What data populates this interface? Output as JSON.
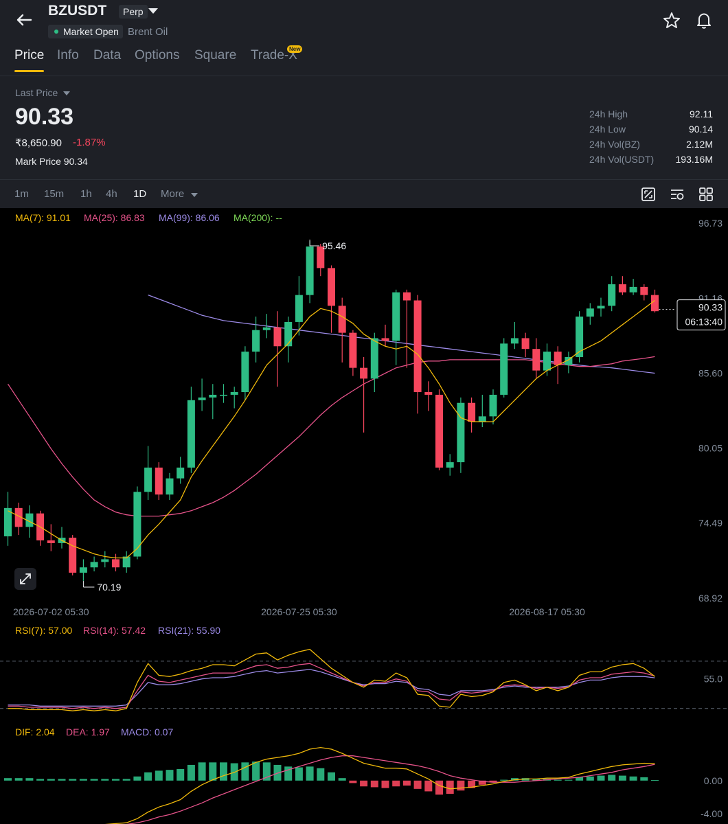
{
  "header": {
    "symbol": "BZUSDT",
    "contract_type": "Perp",
    "market_status": "Market Open",
    "underlying": "Brent Oil",
    "icons": [
      "back-arrow-icon",
      "chevron-down-icon",
      "star-icon",
      "bell-icon"
    ]
  },
  "tabs": [
    {
      "label": "Price",
      "active": true
    },
    {
      "label": "Info",
      "active": false
    },
    {
      "label": "Data",
      "active": false
    },
    {
      "label": "Options",
      "active": false
    },
    {
      "label": "Square",
      "active": false
    },
    {
      "label": "Trade-X",
      "active": false,
      "badge": "New"
    }
  ],
  "price": {
    "last_label": "Last Price",
    "last": "90.33",
    "inr": "₹8,650.90",
    "change": "-1.87%",
    "mark_label": "Mark Price",
    "mark": "90.34"
  },
  "stats": [
    {
      "label": "24h High",
      "value": "92.11"
    },
    {
      "label": "24h Low",
      "value": "90.14"
    },
    {
      "label": "24h Vol(BZ)",
      "value": "2.12M"
    },
    {
      "label": "24h Vol(USDT)",
      "value": "193.16M"
    }
  ],
  "intervals": {
    "items": [
      {
        "label": "1m",
        "active": false
      },
      {
        "label": "15m",
        "active": false
      },
      {
        "label": "1h",
        "active": false
      },
      {
        "label": "4h",
        "active": false
      },
      {
        "label": "1D",
        "active": true
      }
    ],
    "more_label": "More",
    "tool_icons": [
      "chart-settings-icon",
      "indicator-settings-icon",
      "layout-grid-icon"
    ]
  },
  "chart_data": [
    {
      "type": "candlestick",
      "ma_legend": [
        {
          "text": "MA(7): 91.01",
          "color": "#f0b90b"
        },
        {
          "text": "MA(25): 86.83",
          "color": "#e6538a"
        },
        {
          "text": "MA(99): 86.06",
          "color": "#9b8ae6"
        },
        {
          "text": "MA(200): --",
          "color": "#7ed957"
        }
      ],
      "y_ticks": [
        "96.73",
        "91.16",
        "85.60",
        "80.05",
        "74.49",
        "68.92"
      ],
      "ylim": [
        68.92,
        96.73
      ],
      "x_ticks": [
        {
          "label": "2026-07-02 05:30",
          "index": 4
        },
        {
          "label": "2026-07-25 05:30",
          "index": 27
        },
        {
          "label": "2026-08-17 05:30",
          "index": 50
        }
      ],
      "high_marker": {
        "value": "95.46",
        "index": 28
      },
      "low_marker": {
        "value": "70.19",
        "index": 7
      },
      "current_price_tag": {
        "price": "90.33",
        "countdown": "06:13:40"
      },
      "candles": [
        [
          73.5,
          75.6,
          72.8,
          76.8
        ],
        [
          75.6,
          74.2,
          73.6,
          76.0
        ],
        [
          74.2,
          75.2,
          73.4,
          75.8
        ],
        [
          75.2,
          73.2,
          72.8,
          75.4
        ],
        [
          73.2,
          73.0,
          72.4,
          74.4
        ],
        [
          73.0,
          73.4,
          72.6,
          74.2
        ],
        [
          73.4,
          70.8,
          70.6,
          73.6
        ],
        [
          70.8,
          71.2,
          70.2,
          71.8
        ],
        [
          71.2,
          71.6,
          70.9,
          72.0
        ],
        [
          71.6,
          71.8,
          71.2,
          72.4
        ],
        [
          71.8,
          71.2,
          70.9,
          72.2
        ],
        [
          71.2,
          72.0,
          70.8,
          72.4
        ],
        [
          72.0,
          76.8,
          71.8,
          77.2
        ],
        [
          76.8,
          78.6,
          76.2,
          80.2
        ],
        [
          78.6,
          76.6,
          76.2,
          79.0
        ],
        [
          76.6,
          77.8,
          76.2,
          78.2
        ],
        [
          77.8,
          78.6,
          77.4,
          79.4
        ],
        [
          78.6,
          83.6,
          78.2,
          84.6
        ],
        [
          83.6,
          83.8,
          82.8,
          85.2
        ],
        [
          83.8,
          84.0,
          82.2,
          84.8
        ],
        [
          84.0,
          84.0,
          83.4,
          84.8
        ],
        [
          84.0,
          84.2,
          83.0,
          84.6
        ],
        [
          84.2,
          87.2,
          83.6,
          87.6
        ],
        [
          87.2,
          88.8,
          86.4,
          89.8
        ],
        [
          88.8,
          89.0,
          88.2,
          90.0
        ],
        [
          89.0,
          87.6,
          84.6,
          90.2
        ],
        [
          87.6,
          89.4,
          86.4,
          89.8
        ],
        [
          89.4,
          91.4,
          88.4,
          92.8
        ],
        [
          91.4,
          95.0,
          90.8,
          95.4
        ],
        [
          95.0,
          93.4,
          92.8,
          95.2
        ],
        [
          93.4,
          90.6,
          88.6,
          93.6
        ],
        [
          90.6,
          88.6,
          86.4,
          91.2
        ],
        [
          88.6,
          86.0,
          85.4,
          88.8
        ],
        [
          86.0,
          85.2,
          81.2,
          86.8
        ],
        [
          85.2,
          88.2,
          84.2,
          88.6
        ],
        [
          88.2,
          88.0,
          87.6,
          89.2
        ],
        [
          88.0,
          91.6,
          86.2,
          91.8
        ],
        [
          91.6,
          91.0,
          86.0,
          91.8
        ],
        [
          91.0,
          84.2,
          82.6,
          91.4
        ],
        [
          84.2,
          84.0,
          82.8,
          85.0
        ],
        [
          84.0,
          78.6,
          78.4,
          84.4
        ],
        [
          78.6,
          79.0,
          78.0,
          79.6
        ],
        [
          79.0,
          83.4,
          78.2,
          83.8
        ],
        [
          83.4,
          82.0,
          81.2,
          83.8
        ],
        [
          82.0,
          82.4,
          81.6,
          84.0
        ],
        [
          82.4,
          84.0,
          81.8,
          84.4
        ],
        [
          84.0,
          87.8,
          83.8,
          88.2
        ],
        [
          87.8,
          88.2,
          87.4,
          89.4
        ],
        [
          88.2,
          87.4,
          86.8,
          88.6
        ],
        [
          87.4,
          85.8,
          85.2,
          88.2
        ],
        [
          85.8,
          87.2,
          85.4,
          87.8
        ],
        [
          87.2,
          86.2,
          84.8,
          87.6
        ],
        [
          86.2,
          86.8,
          85.6,
          87.2
        ],
        [
          86.8,
          89.8,
          86.4,
          90.2
        ],
        [
          89.8,
          90.4,
          89.2,
          90.8
        ],
        [
          90.4,
          90.6,
          89.8,
          91.2
        ],
        [
          90.6,
          92.2,
          90.2,
          92.8
        ],
        [
          92.2,
          91.6,
          91.4,
          92.8
        ],
        [
          91.6,
          92.0,
          91.4,
          92.6
        ],
        [
          92.0,
          91.4,
          91.0,
          92.2
        ],
        [
          91.4,
          90.2,
          90.1,
          91.8
        ]
      ],
      "ma7": [
        75.4,
        75.0,
        74.6,
        74.2,
        73.7,
        73.2,
        72.8,
        72.5,
        72.2,
        72.0,
        71.9,
        71.9,
        72.6,
        73.6,
        74.4,
        75.3,
        76.2,
        77.9,
        79.1,
        80.2,
        81.3,
        82.4,
        83.6,
        84.9,
        86.2,
        87.0,
        87.8,
        88.8,
        89.8,
        90.4,
        90.2,
        89.8,
        89.3,
        88.5,
        88.0,
        87.6,
        87.4,
        87.6,
        87.0,
        86.0,
        84.8,
        83.4,
        82.3,
        82.0,
        82.0,
        82.0,
        82.8,
        83.6,
        84.4,
        85.2,
        85.8,
        86.2,
        86.6,
        87.2,
        87.6,
        88.0,
        88.6,
        89.2,
        89.8,
        90.4,
        91.0
      ],
      "ma25": [
        84.8,
        83.6,
        82.4,
        81.2,
        80.0,
        78.9,
        77.9,
        77.0,
        76.2,
        75.7,
        75.3,
        75.1,
        75.0,
        75.0,
        75.0,
        75.1,
        75.2,
        75.4,
        75.7,
        76.0,
        76.4,
        76.9,
        77.5,
        78.1,
        78.8,
        79.5,
        80.2,
        80.9,
        81.7,
        82.5,
        83.2,
        83.8,
        84.3,
        84.8,
        85.2,
        85.6,
        86.0,
        86.2,
        86.4,
        86.5,
        86.5,
        86.6,
        86.6,
        86.6,
        86.6,
        86.6,
        86.6,
        86.6,
        86.6,
        86.5,
        86.4,
        86.3,
        86.2,
        86.1,
        86.1,
        86.2,
        86.3,
        86.5,
        86.6,
        86.7,
        86.83
      ],
      "ma99_start": 13,
      "ma99": [
        91.4,
        91.1,
        90.8,
        90.5,
        90.2,
        89.9,
        89.7,
        89.5,
        89.4,
        89.3,
        89.2,
        89.1,
        89.0,
        88.9,
        88.8,
        88.7,
        88.6,
        88.5,
        88.4,
        88.3,
        88.2,
        88.1,
        88.0,
        87.9,
        87.8,
        87.7,
        87.6,
        87.5,
        87.4,
        87.3,
        87.2,
        87.1,
        87.0,
        86.9,
        86.8,
        86.7,
        86.6,
        86.5,
        86.4,
        86.3,
        86.2,
        86.1,
        86.06,
        86.0,
        85.9,
        85.8,
        85.7,
        85.6
      ]
    },
    {
      "type": "line",
      "legend": [
        {
          "text": "RSI(7): 57.00",
          "color": "#f0b90b"
        },
        {
          "text": "RSI(14): 57.42",
          "color": "#e6538a"
        },
        {
          "text": "RSI(21): 55.90",
          "color": "#9b8ae6"
        }
      ],
      "y_ticks": [
        "55.0"
      ],
      "guide_levels": [
        70,
        30
      ],
      "series": [
        {
          "name": "RSI(7)",
          "values": [
            30,
            30,
            29,
            29,
            29,
            29,
            28,
            29,
            28,
            29,
            28,
            30,
            52,
            68,
            58,
            57,
            59,
            62,
            64,
            67,
            67,
            66,
            71,
            76,
            77,
            71,
            75,
            78,
            80,
            72,
            64,
            58,
            52,
            48,
            54,
            53,
            60,
            56,
            42,
            41,
            32,
            31,
            42,
            40,
            41,
            44,
            52,
            54,
            50,
            45,
            48,
            45,
            48,
            58,
            61,
            61,
            65,
            67,
            68,
            64,
            57
          ]
        },
        {
          "name": "RSI(14)",
          "values": [
            32,
            32,
            31,
            31,
            31,
            31,
            30,
            31,
            30,
            31,
            30,
            31,
            45,
            58,
            53,
            52,
            54,
            56,
            58,
            60,
            60,
            60,
            63,
            66,
            67,
            64,
            65,
            67,
            68,
            64,
            60,
            56,
            52,
            49,
            52,
            52,
            55,
            53,
            45,
            44,
            38,
            37,
            44,
            43,
            44,
            45,
            49,
            50,
            49,
            47,
            48,
            47,
            48,
            54,
            56,
            56,
            59,
            60,
            61,
            60,
            57.4
          ]
        },
        {
          "name": "RSI(21)",
          "values": [
            33,
            33,
            33,
            32,
            32,
            32,
            32,
            32,
            32,
            32,
            32,
            33,
            42,
            52,
            50,
            50,
            51,
            53,
            55,
            56,
            56,
            57,
            59,
            61,
            62,
            60,
            61,
            62,
            63,
            61,
            58,
            55,
            52,
            50,
            51,
            51,
            53,
            52,
            47,
            46,
            42,
            41,
            45,
            45,
            45,
            46,
            48,
            49,
            48,
            48,
            48,
            48,
            49,
            52,
            54,
            54,
            56,
            57,
            57,
            57,
            55.9
          ]
        }
      ]
    },
    {
      "type": "bar+line",
      "legend": [
        {
          "text": "DIF: 2.04",
          "color": "#f0b90b"
        },
        {
          "text": "DEA: 1.97",
          "color": "#e6538a"
        },
        {
          "text": "MACD: 0.07",
          "color": "#9b8ae6"
        }
      ],
      "y_ticks": [
        "0.00",
        "-4.00"
      ],
      "ylim": [
        -5,
        4.8
      ],
      "series": [
        {
          "name": "DIF",
          "values": [
            -6.0,
            -6.0,
            -5.9,
            -5.9,
            -5.8,
            -5.7,
            -5.6,
            -5.5,
            -5.4,
            -5.3,
            -5.2,
            -5.1,
            -4.6,
            -3.8,
            -3.2,
            -2.8,
            -2.3,
            -1.3,
            -0.5,
            0.1,
            0.6,
            1.0,
            1.6,
            2.2,
            2.6,
            2.8,
            3.0,
            3.3,
            3.8,
            4.0,
            3.8,
            3.3,
            2.7,
            2.1,
            1.8,
            1.5,
            1.5,
            1.4,
            0.8,
            0.2,
            -0.6,
            -1.0,
            -0.9,
            -0.8,
            -0.6,
            -0.4,
            -0.1,
            0.1,
            0.2,
            0.2,
            0.3,
            0.3,
            0.4,
            0.8,
            1.1,
            1.4,
            1.7,
            1.9,
            2.0,
            2.1,
            2.04
          ]
        },
        {
          "name": "DEA",
          "values": [
            -6.4,
            -6.3,
            -6.2,
            -6.1,
            -6.0,
            -5.9,
            -5.8,
            -5.7,
            -5.6,
            -5.5,
            -5.4,
            -5.3,
            -5.1,
            -4.8,
            -4.4,
            -4.1,
            -3.7,
            -3.2,
            -2.7,
            -2.1,
            -1.6,
            -1.1,
            -0.6,
            -0.1,
            0.4,
            0.9,
            1.3,
            1.7,
            2.1,
            2.5,
            2.8,
            3.0,
            3.0,
            2.8,
            2.6,
            2.4,
            2.2,
            2.0,
            1.8,
            1.5,
            1.1,
            0.6,
            0.3,
            0.1,
            -0.1,
            -0.2,
            -0.2,
            -0.2,
            -0.1,
            0.0,
            0.1,
            0.2,
            0.3,
            0.4,
            0.6,
            0.8,
            1.0,
            1.3,
            1.5,
            1.7,
            1.97
          ]
        }
      ],
      "histogram": [
        0.3,
        0.3,
        0.3,
        0.2,
        0.2,
        0.2,
        0.2,
        0.2,
        0.2,
        0.2,
        0.2,
        0.2,
        0.5,
        1.0,
        1.2,
        1.3,
        1.4,
        1.9,
        2.2,
        2.2,
        2.2,
        2.1,
        2.2,
        2.3,
        2.2,
        1.9,
        1.7,
        1.6,
        1.7,
        1.5,
        1.0,
        0.3,
        -0.3,
        -0.7,
        -0.8,
        -0.9,
        -0.7,
        -0.6,
        -1.0,
        -1.3,
        -1.7,
        -1.6,
        -1.2,
        -0.9,
        -0.5,
        -0.2,
        0.1,
        0.3,
        0.3,
        0.2,
        0.2,
        0.1,
        0.1,
        0.4,
        0.5,
        0.6,
        0.7,
        0.6,
        0.5,
        0.4,
        0.07
      ]
    }
  ]
}
